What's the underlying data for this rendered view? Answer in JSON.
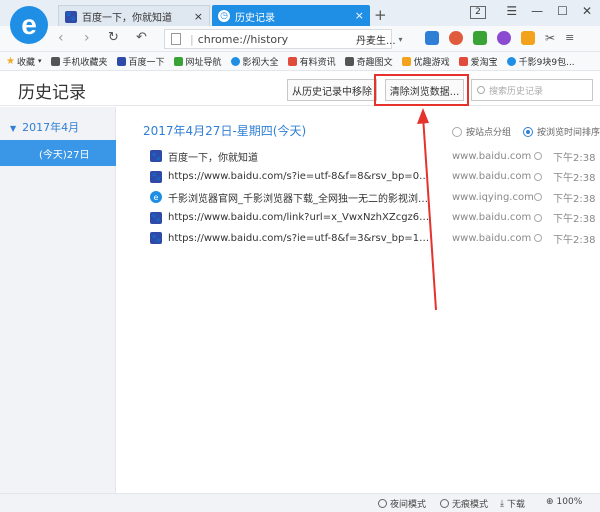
{
  "browser": {
    "tabs": [
      {
        "title": "百度一下，你就知道",
        "icon": "baidu-paw-icon"
      },
      {
        "title": "历史记录",
        "icon": "history-icon"
      }
    ],
    "tab_count": "2",
    "address": "chrome://history",
    "search_box": "丹麦生...",
    "accent_color": "#1f8fe6"
  },
  "bookmarks": [
    {
      "label": "收藏"
    },
    {
      "label": "手机收藏夹"
    },
    {
      "label": "百度一下"
    },
    {
      "label": "网址导航"
    },
    {
      "label": "影视大全"
    },
    {
      "label": "有料资讯"
    },
    {
      "label": "奇趣图文"
    },
    {
      "label": "优趣游戏"
    },
    {
      "label": "爱淘宝"
    },
    {
      "label": "千影9块9包..."
    }
  ],
  "history": {
    "page_title": "历史记录",
    "remove_button": "从历史记录中移除",
    "clear_button": "清除浏览数据...",
    "search_placeholder": "搜索历史记录",
    "month": "2017年4月",
    "selected_day": "(今天)27日",
    "day_heading": "2017年4月27日-星期四(今天)",
    "group_by_site": "按站点分组",
    "sort_by_time": "按浏览时间排序",
    "entries": [
      {
        "title": "百度一下，你就知道",
        "domain": "www.baidu.com",
        "time": "下午2:38",
        "icon": "baidu-paw-icon"
      },
      {
        "title": "https://www.baidu.com/s?ie=utf-8&f=8&rsv_bp=0&rs...",
        "domain": "www.baidu.com",
        "time": "下午2:38",
        "icon": "baidu-paw-icon"
      },
      {
        "title": "千影浏览器官网_千影浏览器下载_全网独一无二的影视浏览器",
        "domain": "www.iqying.com",
        "time": "下午2:38",
        "icon": "browser-e-icon"
      },
      {
        "title": "https://www.baidu.com/link?url=x_VwxNzhXZcgz6uN3...",
        "domain": "www.baidu.com",
        "time": "下午2:38",
        "icon": "baidu-paw-icon"
      },
      {
        "title": "https://www.baidu.com/s?ie=utf-8&f=3&rsv_bp=1&rs...",
        "domain": "www.baidu.com",
        "time": "下午2:38",
        "icon": "baidu-paw-icon"
      }
    ]
  },
  "statusbar": {
    "night_mode": "夜间模式",
    "no_trace": "无痕模式",
    "download": "下载",
    "zoom": "100%"
  },
  "annotation_color": "#e5322d"
}
